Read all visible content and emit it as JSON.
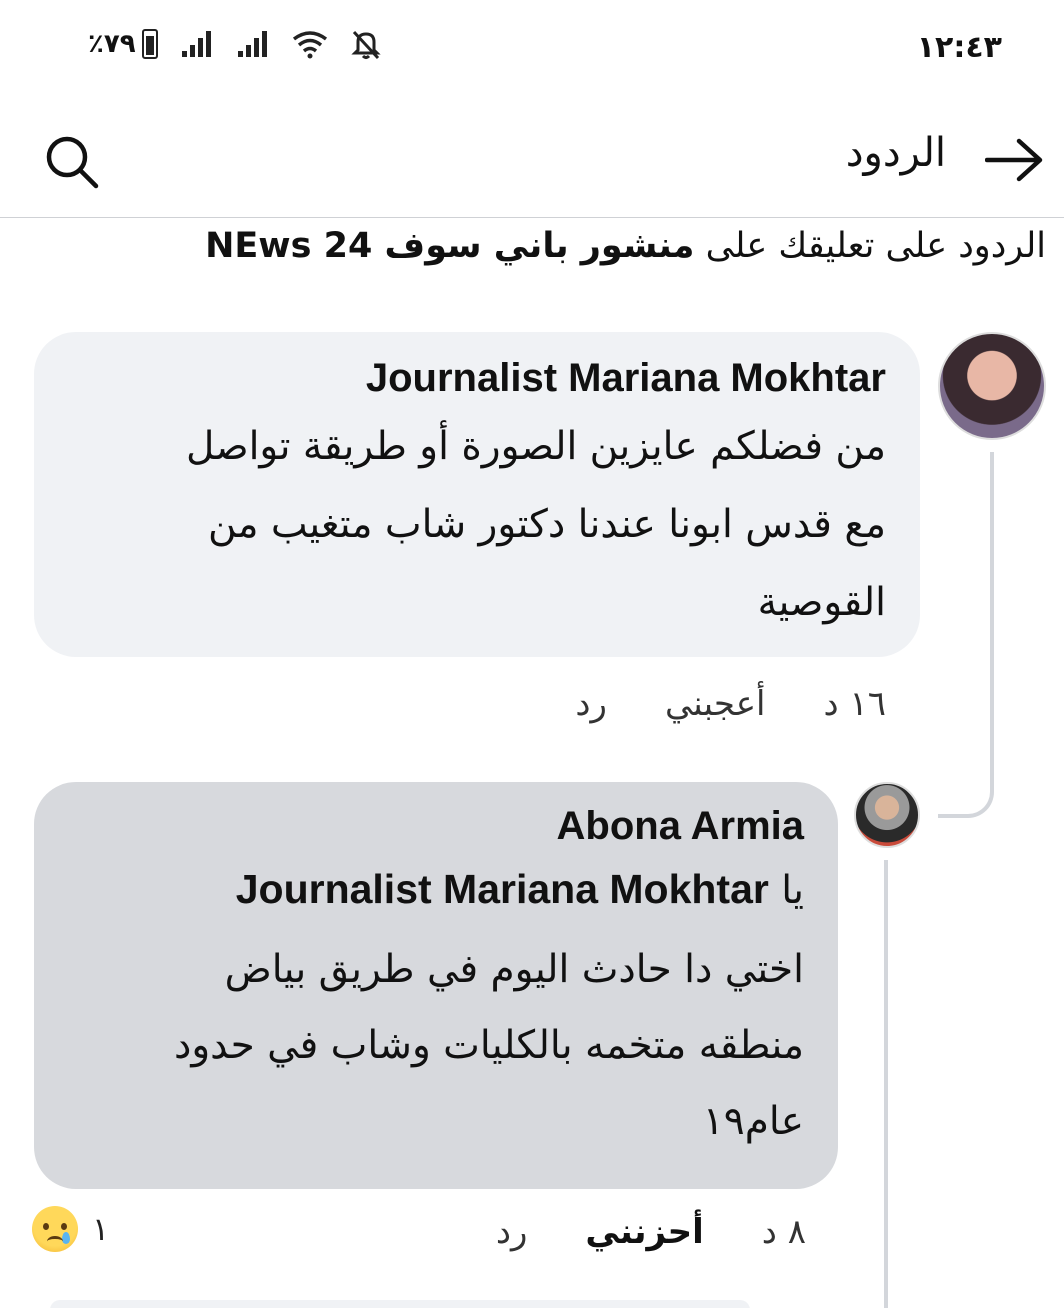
{
  "status_bar": {
    "time": "١٢:٤٣",
    "battery": "٪٧٩",
    "icons": [
      "battery-icon",
      "signal-icon",
      "signal-icon",
      "wifi-icon",
      "mute-icon"
    ]
  },
  "header": {
    "title": "الردود",
    "back_icon": "arrow-right-icon",
    "search_icon": "search-icon"
  },
  "context": {
    "prefix": "الردود على تعليقك على ",
    "post_name": "منشور باني سوف NEws 24"
  },
  "comments": [
    {
      "author": "Journalist Mariana Mokhtar",
      "lines": [
        "من فضلكم عايزين الصورة أو طريقة تواصل",
        "مع قدس ابونا عندنا دكتور شاب متغيب من",
        "القوصية"
      ],
      "time": "١٦ د",
      "like_label": "أعجبني",
      "reply_label": "رد"
    },
    {
      "author": "Abona Armia",
      "mention_prefix": "يا",
      "mention": "Journalist Mariana Mokhtar",
      "lines": [
        "اختي دا حادث اليوم في طريق بياض",
        "منطقه متخمه بالكليات وشاب في حدود",
        "عام١٩"
      ],
      "time": "٨ د",
      "like_label": "أحزنني",
      "reply_label": "رد",
      "reaction_count": "١",
      "reaction_icon": "sad-emoji-icon"
    }
  ]
}
